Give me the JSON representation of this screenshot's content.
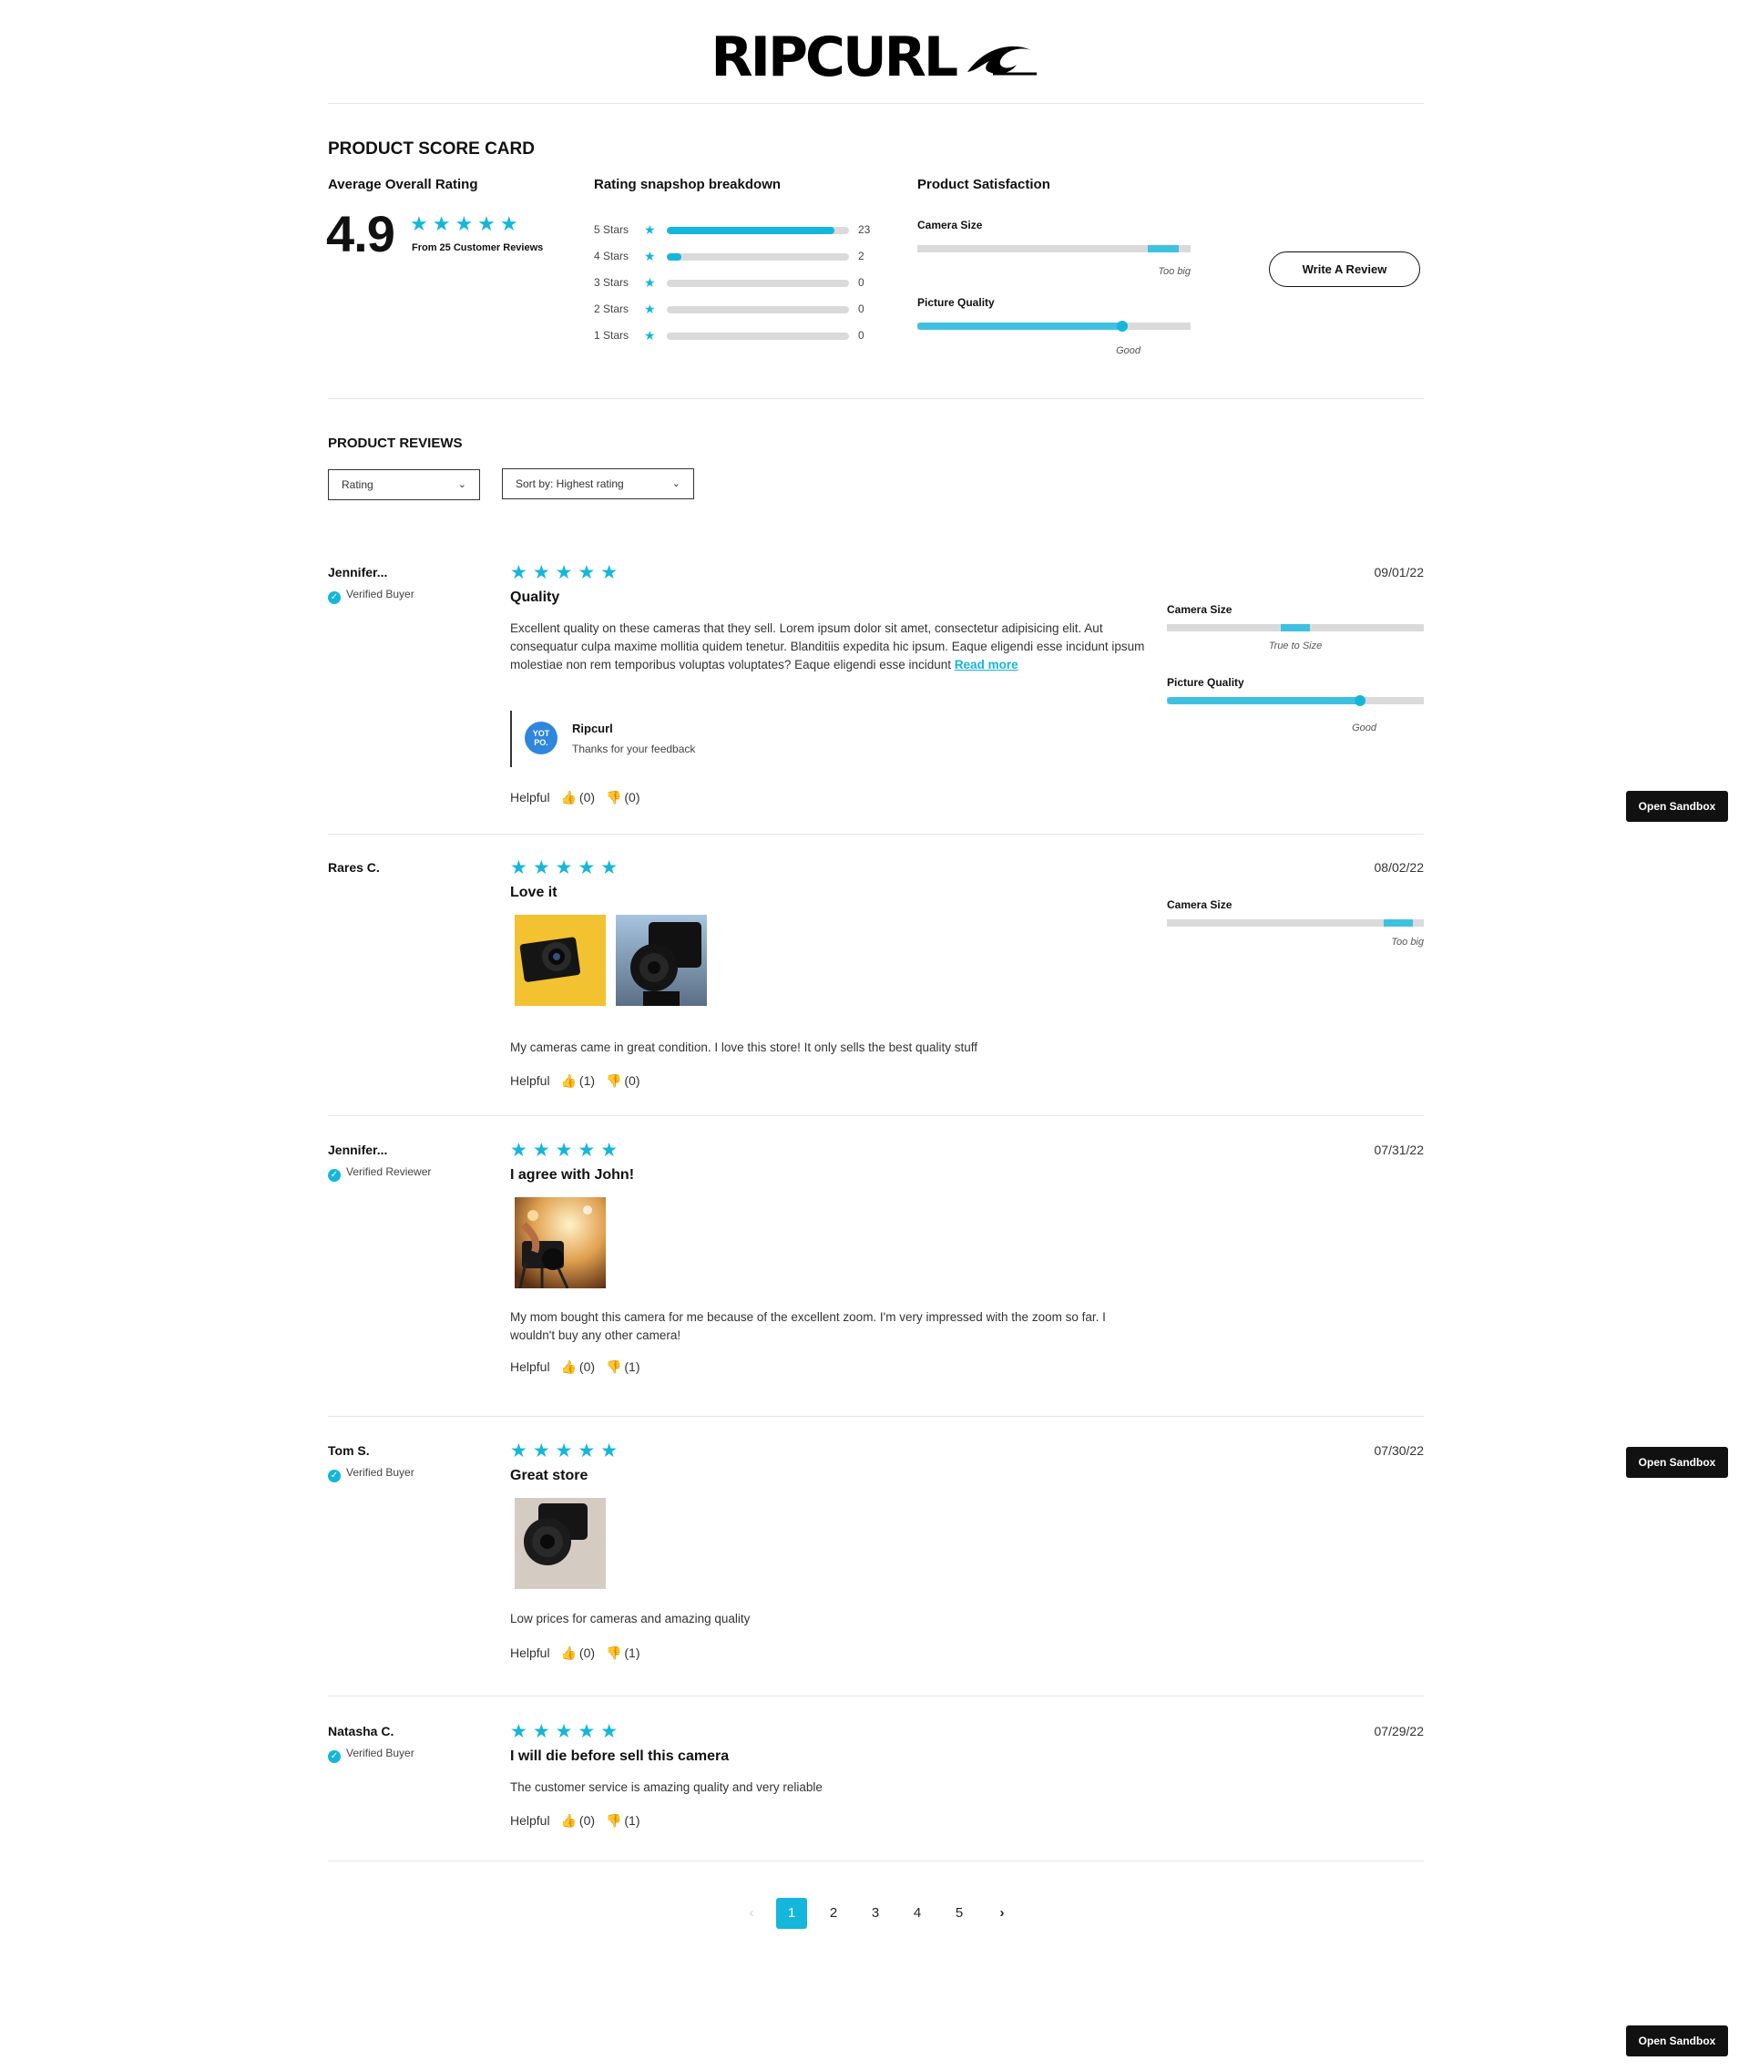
{
  "brand": {
    "logo_text": "RIPCURL"
  },
  "scorecard": {
    "heading": "PRODUCT SCORE CARD",
    "average": {
      "title": "Average Overall Rating",
      "value": "4.9",
      "stars": "★★★★★",
      "subtext": "From 25 Customer Reviews"
    },
    "breakdown": {
      "title": "Rating snapshop breakdown",
      "star_glyph": "★",
      "rows": [
        {
          "label": "5 Stars",
          "count": "23",
          "fraction": 0.92
        },
        {
          "label": "4 Stars",
          "count": "2",
          "fraction": 0.08
        },
        {
          "label": "3 Stars",
          "count": "0",
          "fraction": 0
        },
        {
          "label": "2 Stars",
          "count": "0",
          "fraction": 0
        },
        {
          "label": "1 Stars",
          "count": "0",
          "fraction": 0
        }
      ]
    },
    "satisfaction": {
      "title": "Product Satisfaction",
      "items": [
        {
          "label": "Camera Size",
          "caption": "Too big",
          "level": 0.9
        },
        {
          "label": "Picture Quality",
          "caption": "Good",
          "level": 0.75
        }
      ]
    },
    "write_review_label": "Write A Review"
  },
  "reviews_section": {
    "heading": "PRODUCT REVIEWS",
    "filter_label": "Rating",
    "sort_label": "Sort by: Highest rating",
    "chevron": "⌄"
  },
  "reviews": [
    {
      "name": "Jennifer...",
      "badge": "Verified Buyer",
      "stars": "★★★★★",
      "title": "Quality",
      "date": "09/01/22",
      "body": "Excellent quality on these cameras that they sell. Lorem ipsum dolor sit amet, consectetur adipisicing elit. Aut consequatur culpa maxime mollitia quidem tenetur. Blanditiis expedita hic ipsum. Eaque eligendi esse incidunt ipsum molestiae non rem temporibus voluptas voluptates?  Eaque eligendi esse incidunt",
      "read_more": "Read more",
      "reply": {
        "avatar": "YOT PO.",
        "name": "Ripcurl",
        "text": "Thanks for your feedback"
      },
      "helpful_label": "Helpful",
      "up": "(0)",
      "down": "(0)",
      "attributes": [
        {
          "label": "Camera Size",
          "caption": "True to Size",
          "level": 0.5
        },
        {
          "label": "Picture Quality",
          "caption": "Good",
          "level": 0.75
        }
      ]
    },
    {
      "name": "Rares C.",
      "stars": "★★★★★",
      "title": "Love it",
      "date": "08/02/22",
      "body": "My cameras came in great condition. I love this store! It only sells the best quality stuff",
      "helpful_label": "Helpful",
      "up": "(1)",
      "down": "(0)",
      "attributes": [
        {
          "label": "Camera Size",
          "caption": "Too big",
          "level": 0.9
        }
      ]
    },
    {
      "name": "Jennifer...",
      "badge": "Verified Reviewer",
      "stars": "★★★★★",
      "title": "I agree with John!",
      "date": "07/31/22",
      "body": "My mom bought this camera for me because of the excellent zoom. I'm very impressed with the zoom so far. I wouldn't buy any other camera!",
      "helpful_label": "Helpful",
      "up": "(0)",
      "down": "(1)"
    },
    {
      "name": "Tom S.",
      "badge": "Verified Buyer",
      "stars": "★★★★★",
      "title": "Great store",
      "date": "07/30/22",
      "body": "Low prices for cameras and amazing quality",
      "helpful_label": "Helpful",
      "up": "(0)",
      "down": "(1)"
    },
    {
      "name": "Natasha C.",
      "badge": "Verified Buyer",
      "stars": "★★★★★",
      "title": "I will die before sell this camera",
      "date": "07/29/22",
      "body": "The customer service is amazing quality and very reliable",
      "helpful_label": "Helpful",
      "up": "(0)",
      "down": "(1)"
    }
  ],
  "icons": {
    "check": "✓",
    "thumb_up": "👍",
    "thumb_down": "👎",
    "prev": "‹",
    "next": "›"
  },
  "pagination": {
    "pages": [
      "1",
      "2",
      "3",
      "4",
      "5"
    ],
    "current": "1"
  },
  "sandbox_label": "Open Sandbox",
  "colors": {
    "accent": "#14b6dc",
    "bar_track": "#dadada",
    "dark_button": "#111111"
  }
}
